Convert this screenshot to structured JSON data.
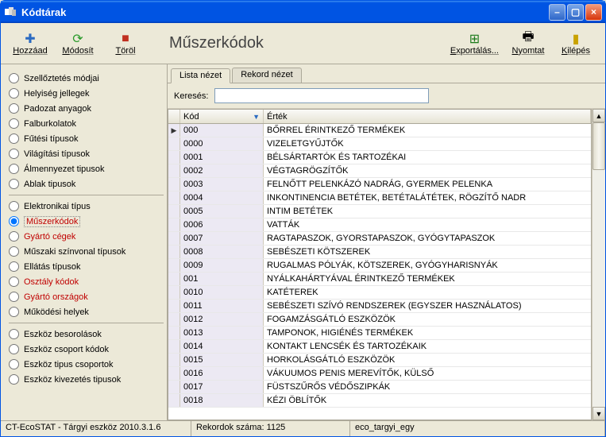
{
  "window": {
    "title": "Kódtárak"
  },
  "toolbar": {
    "add": "Hozzáad",
    "modify": "Módosít",
    "delete": "Töröl",
    "export": "Exportálás...",
    "print": "Nyomtat",
    "exit": "Kilépés"
  },
  "heading": "Műszerkódok",
  "sidebar": {
    "groups": [
      [
        "Szellőztetés módjai",
        "Helyiség jellegek",
        "Padozat anyagok",
        "Falburkolatok",
        "Fűtési típusok",
        "Világítási típusok",
        "Álmennyezet tipusok",
        "Ablak tipusok"
      ],
      [
        "Elektronikai típus",
        "Műszerkódok",
        "Gyártó cégek",
        "Műszaki színvonal típusok",
        "Ellátás típusok",
        "Osztály kódok",
        "Gyártó országok",
        "Működési helyek"
      ],
      [
        "Eszköz besorolások",
        "Eszköz csoport kódok",
        "Eszköz tipus csoportok",
        "Eszköz kivezetés tipusok"
      ]
    ],
    "redItems": [
      "Műszerkódok",
      "Gyártó cégek",
      "Osztály kódok",
      "Gyártó országok"
    ],
    "selected": "Műszerkódok"
  },
  "tabs": {
    "list": "Lista nézet",
    "record": "Rekord nézet",
    "active": "list"
  },
  "search": {
    "label": "Keresés:",
    "value": ""
  },
  "grid": {
    "headers": {
      "kod": "Kód",
      "ertek": "Érték"
    },
    "rows": [
      {
        "k": "000",
        "v": "BŐRREL ÉRINTKEZŐ TERMÉKEK"
      },
      {
        "k": "0000",
        "v": "VIZELETGYŰJTŐK"
      },
      {
        "k": "0001",
        "v": "BÉLSÁRTARTÓK ÉS TARTOZÉKAI"
      },
      {
        "k": "0002",
        "v": "VÉGTAGRÖGZÍTŐK"
      },
      {
        "k": "0003",
        "v": "FELNŐTT PELENKÁZÓ NADRÁG, GYERMEK PELENKA"
      },
      {
        "k": "0004",
        "v": "INKONTINENCIA BETÉTEK, BETÉTALÁTÉTEK, RÖGZÍTŐ NADR"
      },
      {
        "k": "0005",
        "v": "INTIM BETÉTEK"
      },
      {
        "k": "0006",
        "v": "VATTÁK"
      },
      {
        "k": "0007",
        "v": "RAGTAPASZOK, GYORSTAPASZOK, GYÓGYTAPASZOK"
      },
      {
        "k": "0008",
        "v": "SEBÉSZETI KÖTSZEREK"
      },
      {
        "k": "0009",
        "v": "RUGALMAS PÓLYÁK, KÖTSZEREK, GYÓGYHARISNYÁK"
      },
      {
        "k": "001",
        "v": "NYÁLKAHÁRTYÁVAL ÉRINTKEZŐ TERMÉKEK"
      },
      {
        "k": "0010",
        "v": "KATÉTEREK"
      },
      {
        "k": "0011",
        "v": "SEBÉSZETI SZÍVÓ RENDSZEREK (EGYSZER HASZNÁLATOS)"
      },
      {
        "k": "0012",
        "v": "FOGAMZÁSGÁTLÓ ESZKÖZÖK"
      },
      {
        "k": "0013",
        "v": "TAMPONOK, HIGIÉNÉS TERMÉKEK"
      },
      {
        "k": "0014",
        "v": "KONTAKT LENCSÉK ÉS TARTOZÉKAIK"
      },
      {
        "k": "0015",
        "v": "HORKOLÁSGÁTLÓ ESZKÖZÖK"
      },
      {
        "k": "0016",
        "v": "VÁKUUMOS PENIS MEREVÍTŐK, KÜLSŐ"
      },
      {
        "k": "0017",
        "v": "FÜSTSZŰRŐS VÉDŐSZIPKÁK"
      },
      {
        "k": "0018",
        "v": "KÉZI ÖBLÍTŐK"
      }
    ]
  },
  "status": {
    "app": "CT-EcoSTAT - Tárgyi eszköz 2010.3.1.6",
    "records": "Rekordok száma:  1125",
    "db": "eco_targyi_egy"
  }
}
